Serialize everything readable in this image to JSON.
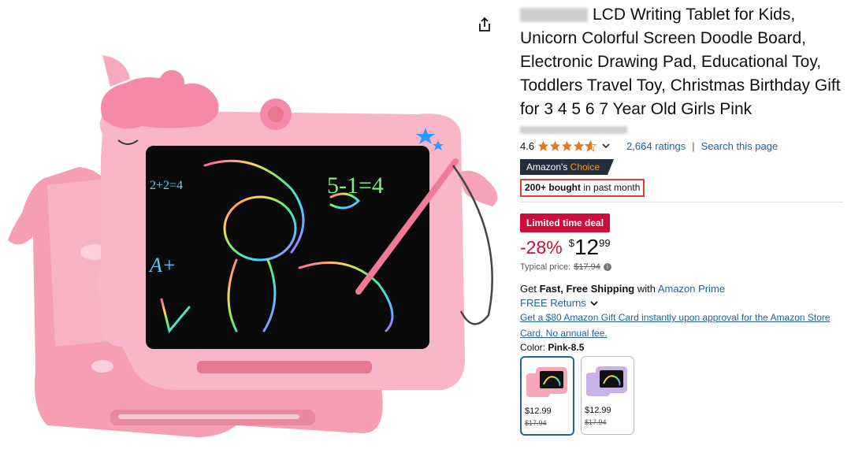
{
  "product": {
    "title": "LCD Writing Tablet for Kids, Unicorn Colorful Screen Doodle Board, Electronic Drawing Pad, Educational Toy, Toddlers Travel Toy, Christmas Birthday Gift for 3 4 5 6 7 Year Old Girls Pink",
    "rating_value": "4.6",
    "rating_stars": 4.6,
    "ratings_count": "2,664 ratings",
    "ratings_sep": "|",
    "search_page": "Search this page",
    "choice_prefix": "Amazon's",
    "choice_suffix": "Choice",
    "bought_bold": "200+ bought",
    "bought_rest": " in past month",
    "deal_badge": "Limited time deal",
    "discount": "-28%",
    "currency": "$",
    "price_whole": "12",
    "price_fraction": "99",
    "typical_label": "Typical price:",
    "typical_price": "$17.94",
    "info_icon_glyph": "i",
    "ship_prefix": "Get ",
    "ship_bold": "Fast, Free Shipping",
    "ship_mid": " with ",
    "ship_link": "Amazon Prime",
    "returns": "FREE Returns",
    "gift_offer": "Get a $80 Amazon Gift Card instantly upon approval for the Amazon Store Card. No annual fee.",
    "color_label": "Color: ",
    "color_value": "Pink-8.5"
  },
  "swatches": [
    {
      "price": "$12.99",
      "old": "$17.94",
      "body_color": "#f4a7b9",
      "selected": true
    },
    {
      "price": "$12.99",
      "old": "$17.94",
      "body_color": "#c9b3e6",
      "selected": false
    }
  ],
  "icons": {
    "share": "share-icon",
    "star": "star-icon",
    "chevron": "chevron-down-icon",
    "info": "info-icon"
  },
  "colors": {
    "link": "#2162a1",
    "deal_red": "#cc0c39",
    "star_orange": "#de7921",
    "choice_bg": "#232f3e",
    "highlight_border": "#e53935"
  },
  "screen_art": {
    "math1": "2+2=4",
    "math2": "5-1=4",
    "letters": "A+"
  }
}
